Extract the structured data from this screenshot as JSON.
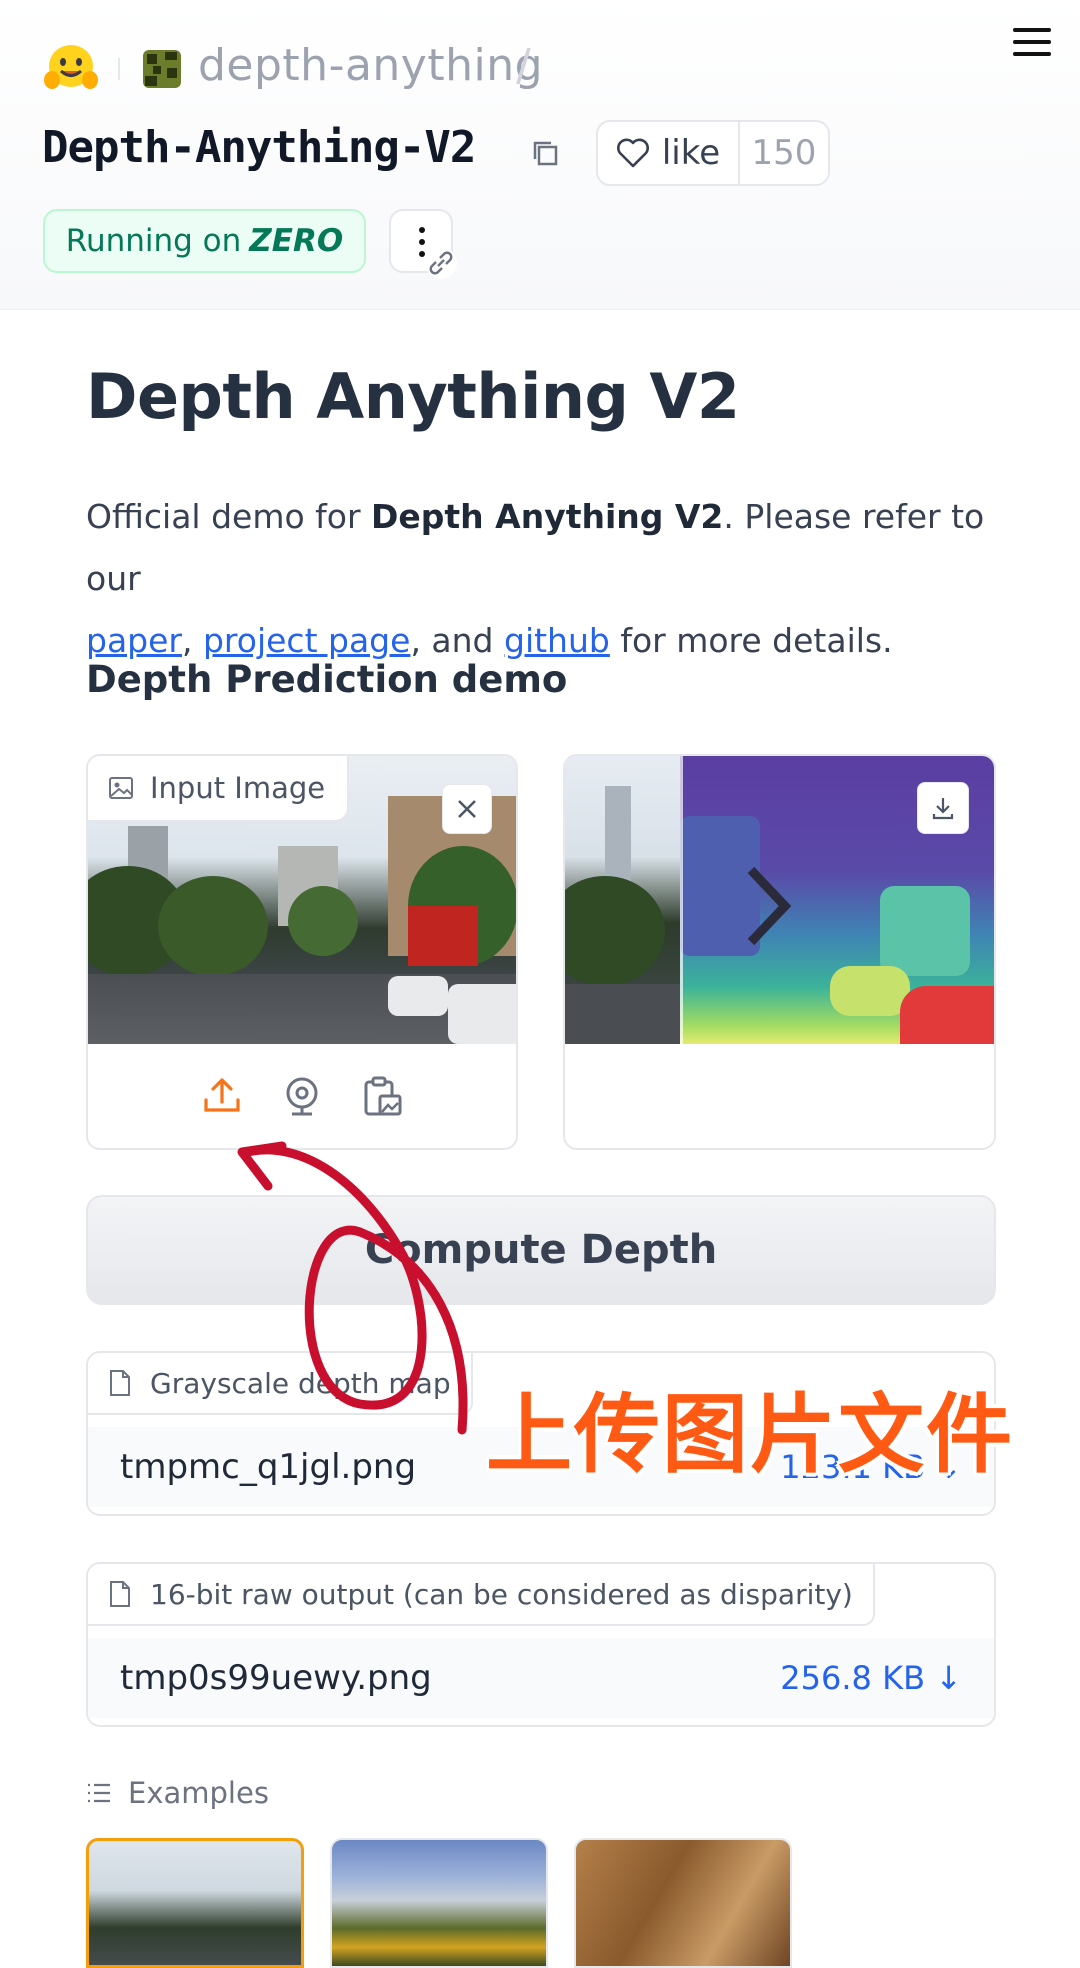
{
  "header": {
    "org_name": "depth-anything",
    "org_slash": "/",
    "repo_name": "Depth-Anything-V2",
    "like_label": "like",
    "like_count": "150",
    "status_prefix": "Running on",
    "status_hardware": "ZERO"
  },
  "main": {
    "title": "Depth Anything V2",
    "desc_intro": "Official demo for ",
    "desc_bold": "Depth Anything V2",
    "desc_mid": ". Please refer to our ",
    "link_paper": "paper",
    "sep_comma": ", ",
    "link_project": "project page",
    "desc_and": ", and ",
    "link_github": "github",
    "desc_end": " for more details.",
    "section_title": "Depth Prediction demo"
  },
  "input_panel": {
    "label": "Input Image"
  },
  "compute_button": "Compute Depth",
  "files": [
    {
      "label": "Grayscale depth map",
      "name": "tmpmc_q1jgl.png",
      "size": "123.1 KB ↓"
    },
    {
      "label": "16-bit raw output (can be considered as disparity)",
      "name": "tmp0s99uewy.png",
      "size": "256.8 KB ↓"
    }
  ],
  "examples": {
    "label": "Examples"
  },
  "annotation": {
    "text": "上传图片文件"
  },
  "colors": {
    "accent_orange": "#ff5a14",
    "link_blue": "#2563eb",
    "status_green": "#047857"
  }
}
